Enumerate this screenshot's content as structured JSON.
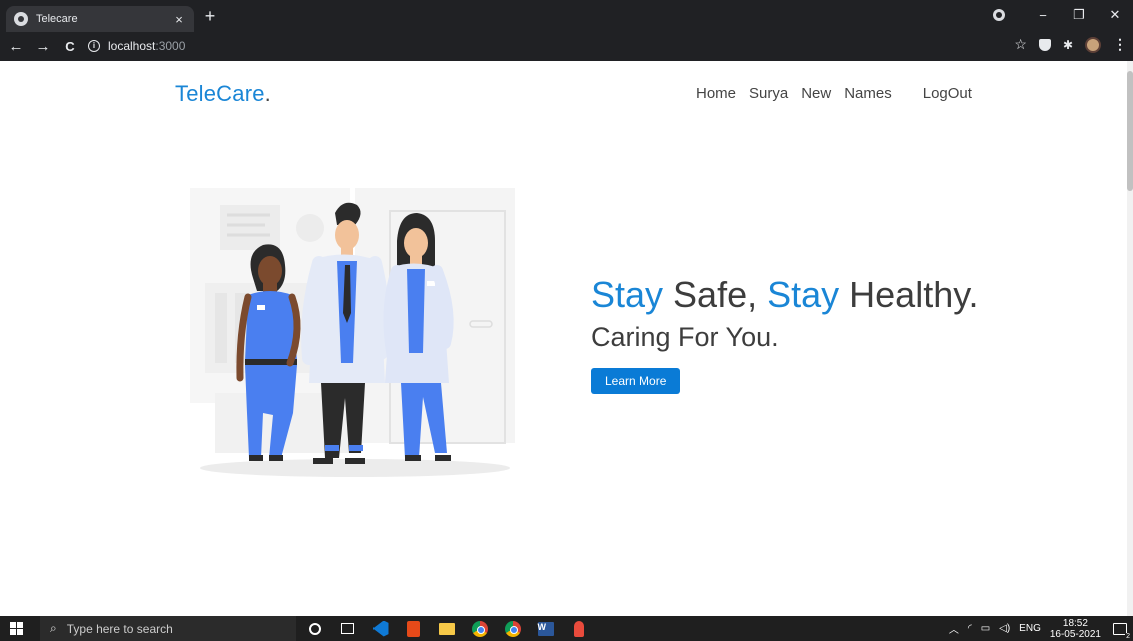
{
  "browser": {
    "tab_title": "Telecare",
    "tab_close": "×",
    "new_tab": "+",
    "url_host": "localhost",
    "url_port": ":3000",
    "back": "←",
    "forward": "→",
    "reload": "C",
    "window": {
      "minimize": "−",
      "restore": "❐",
      "close": "✕"
    },
    "icons": [
      "back-arrow-icon",
      "forward-arrow-icon",
      "reload-icon",
      "info-icon",
      "bookmark-star-icon",
      "pocket-icon",
      "extensions-puzzle-icon",
      "profile-avatar-icon",
      "kebab-menu-icon"
    ]
  },
  "site": {
    "brand_part1": "Tele",
    "brand_part2": "Care",
    "brand_part3": ".",
    "nav": [
      "Home",
      "Surya",
      "New",
      "Names",
      "LogOut"
    ],
    "headline": {
      "w1": "Stay",
      "w2": " Safe, ",
      "w3": "Stay",
      "w4": " Healthy."
    },
    "subline": "Caring For You.",
    "cta": "Learn More",
    "accent_color": "#1a86d6",
    "button_color": "#0a7bd6",
    "illustration": "doctors-illustration"
  },
  "taskbar": {
    "search_placeholder": "Type here to search",
    "apps": [
      "cortana-icon",
      "task-view-icon",
      "vscode-icon",
      "office-icon",
      "file-explorer-icon",
      "chrome-icon",
      "chrome-profile-icon",
      "word-icon",
      "paint-icon"
    ],
    "tray_lang": "ENG",
    "time": "18:52",
    "date": "16-05-2021"
  }
}
